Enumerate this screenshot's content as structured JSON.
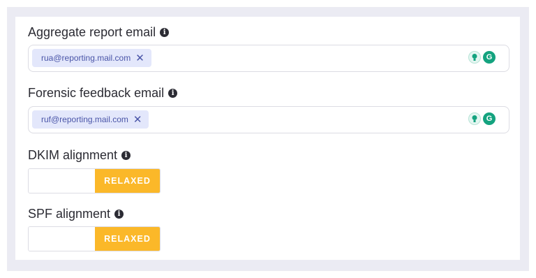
{
  "aggregate": {
    "label": "Aggregate report email",
    "chip": "rua@reporting.mail.com",
    "remove_glyph": "✕"
  },
  "forensic": {
    "label": "Forensic feedback email",
    "chip": "ruf@reporting.mail.com",
    "remove_glyph": "✕"
  },
  "dkim": {
    "label": "DKIM alignment",
    "options": [
      "",
      "RELAXED"
    ],
    "selected": "RELAXED"
  },
  "spf": {
    "label": "SPF alignment",
    "options": [
      "",
      "RELAXED"
    ],
    "selected": "RELAXED"
  },
  "icons": {
    "info": "info-icon",
    "info_glyph": "i",
    "extension_bulb": "lightbulb-icon",
    "extension_g": "grammarly-icon",
    "extension_g_glyph": "G"
  },
  "colors": {
    "accent": "#fbb829",
    "chip_bg": "#e3e7fb",
    "chip_text": "#4a55a8",
    "panel_bg": "#ebebf3"
  }
}
